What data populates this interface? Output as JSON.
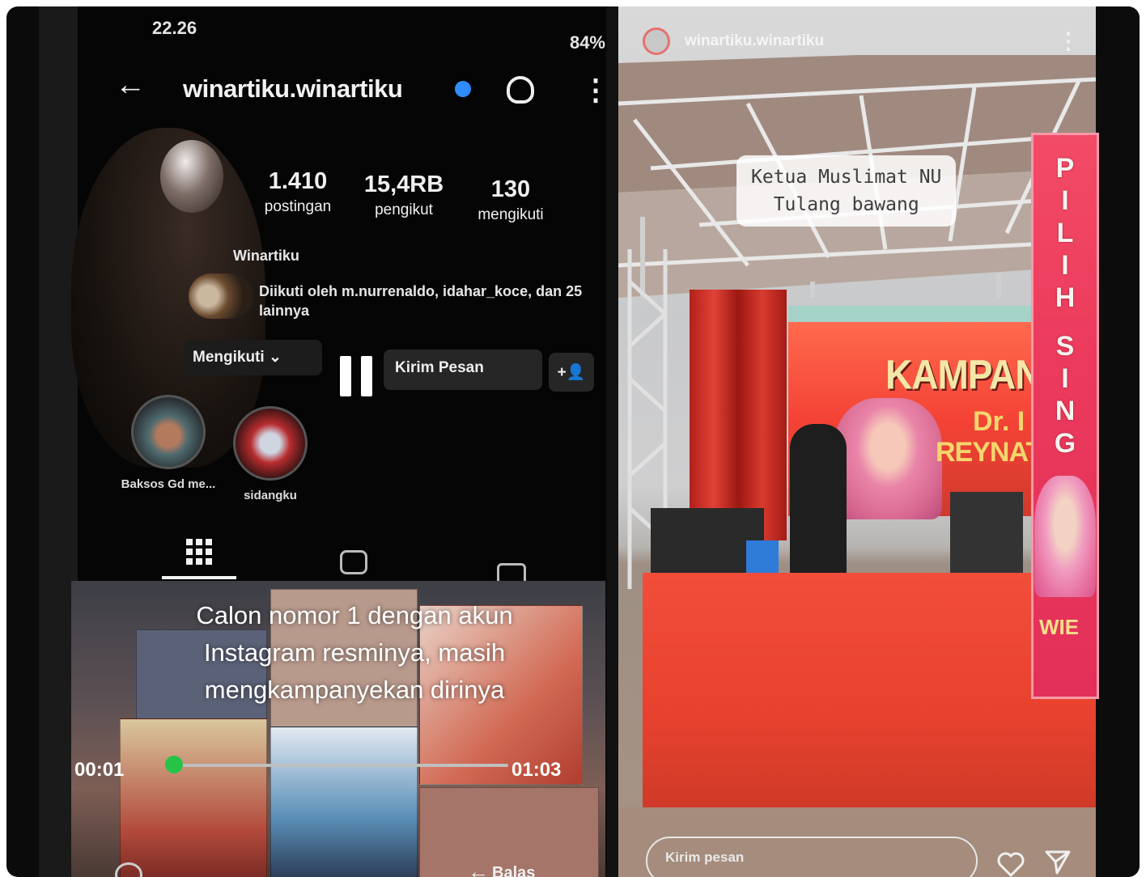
{
  "left_phone": {
    "status_time": "22.26",
    "status_battery": "84%",
    "profile": {
      "username": "winartiku.winartiku",
      "display_name": "Winartiku",
      "followed_by": "Diikuti oleh m.nurrenaldo, idahar_koce, dan 25 lainnya"
    },
    "stats": [
      {
        "value": "1.410",
        "label": "postingan"
      },
      {
        "value": "15,4RB",
        "label": "pengikut"
      },
      {
        "value": "130",
        "label": "mengikuti"
      }
    ],
    "buttons": {
      "following": "Mengikuti ⌄",
      "message": "Kirim Pesan",
      "add_user": "+👤"
    },
    "highlights": [
      {
        "label": "Baksos Gd me..."
      },
      {
        "label": "sidangku"
      }
    ],
    "video": {
      "caption_line1": "Calon nomor 1 dengan akun",
      "caption_line2": "Instagram resminya, masih",
      "caption_line3": "mengkampanyekan dirinya",
      "time_current": "00:01",
      "time_total": "01:03",
      "progress": 0.016
    },
    "reply_label": "Balas"
  },
  "right_phone": {
    "story_username": "winartiku.winartiku",
    "caption_line1": "Ketua Muslimat NU",
    "caption_line2": "Tulang bawang",
    "stage_banner": {
      "title": "KAMPANY",
      "line1": "Dr. I",
      "line2": "REYNATI"
    },
    "side_banner": {
      "vertical_text": [
        "P",
        "I",
        "L",
        "I",
        "H",
        "",
        "S",
        "I",
        "N",
        "G"
      ],
      "name": "WIE"
    },
    "input_placeholder": "Kirim pesan"
  },
  "colors": {
    "progress": "#27c346",
    "verified": "#2f8cff",
    "stage_red": "#e8422f",
    "banner_pink": "#ec3a5c"
  },
  "icons": [
    "back-icon",
    "verified-icon",
    "bell-icon",
    "more-icon",
    "pause-icon",
    "grid-icon",
    "reels-icon",
    "tagged-icon",
    "reply-icon",
    "heart-icon",
    "send-icon"
  ]
}
